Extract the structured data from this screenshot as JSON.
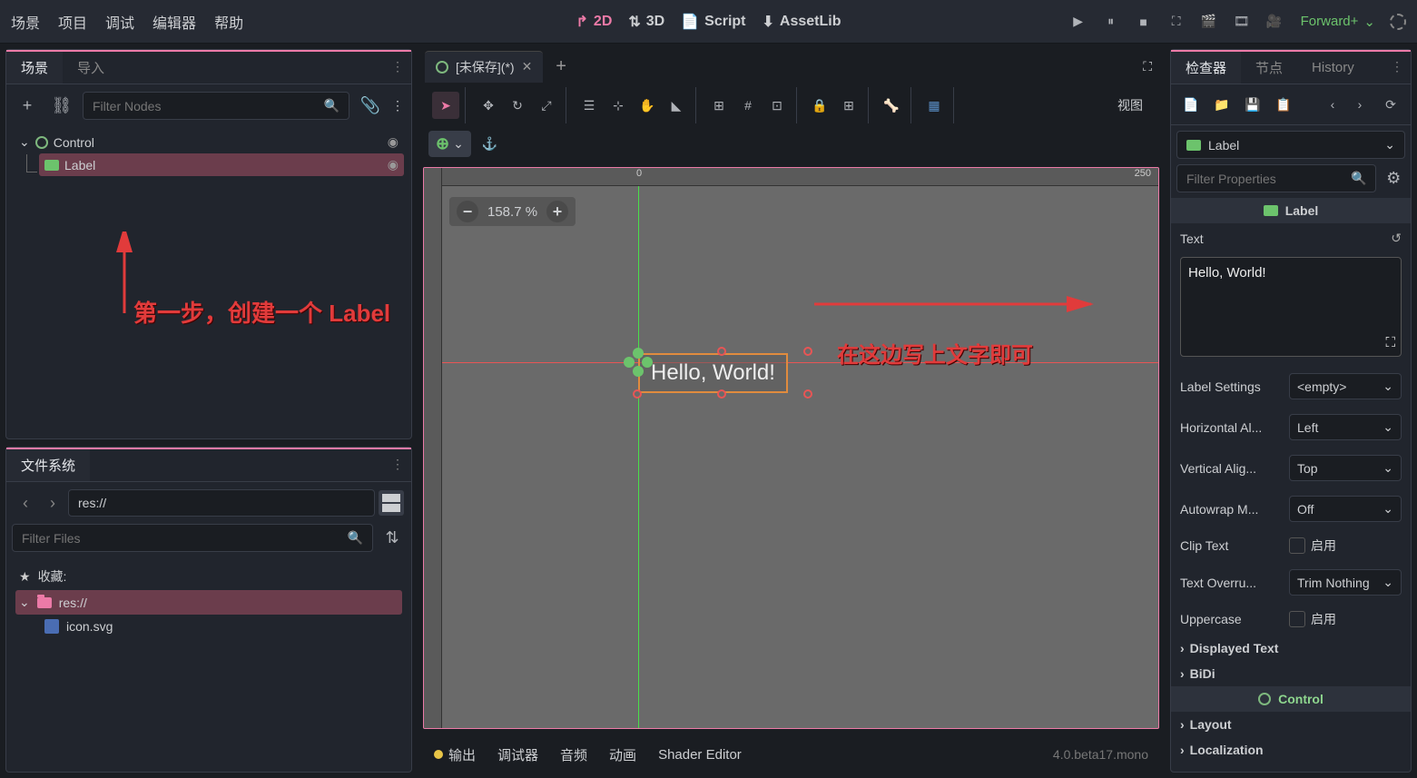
{
  "menubar": [
    "场景",
    "项目",
    "调试",
    "编辑器",
    "帮助"
  ],
  "view_modes": {
    "2d": "2D",
    "3d": "3D",
    "script": "Script",
    "assetlib": "AssetLib"
  },
  "renderer": "Forward+",
  "left": {
    "scene_tabs": {
      "scene": "场景",
      "import": "导入"
    },
    "filter_nodes_placeholder": "Filter Nodes",
    "tree": {
      "root": "Control",
      "child": "Label"
    },
    "annotation1": "第一步，创建一个 Label",
    "fs_title": "文件系统",
    "fs_path": "res://",
    "filter_files_placeholder": "Filter Files",
    "fs_items": {
      "fav": "收藏:",
      "res": "res://",
      "icon": "icon.svg"
    }
  },
  "center": {
    "tab_title": "[未保存](*)",
    "view_btn": "视图",
    "zoom": "158.7 %",
    "ruler_0": "0",
    "ruler_250": "250",
    "canvas_text": "Hello, World!",
    "annotation2": "在这边写上文字即可",
    "bottom": {
      "output": "输出",
      "debugger": "调试器",
      "audio": "音频",
      "anim": "动画",
      "shader": "Shader Editor",
      "version": "4.0.beta17.mono"
    }
  },
  "inspector": {
    "tabs": {
      "inspector": "检查器",
      "node": "节点",
      "history": "History"
    },
    "resource": "Label",
    "filter_placeholder": "Filter Properties",
    "section_label": "Label",
    "section_control": "Control",
    "props": {
      "text": "Text",
      "text_value": "Hello, World!",
      "label_settings": "Label Settings",
      "label_settings_val": "<empty>",
      "h_align": "Horizontal Al...",
      "h_align_val": "Left",
      "v_align": "Vertical Alig...",
      "v_align_val": "Top",
      "autowrap": "Autowrap M...",
      "autowrap_val": "Off",
      "clip_text": "Clip Text",
      "enable": "启用",
      "text_overrun": "Text Overru...",
      "text_overrun_val": "Trim Nothing",
      "uppercase": "Uppercase",
      "displayed_text": "Displayed Text",
      "bidi": "BiDi",
      "layout": "Layout",
      "localization": "Localization"
    }
  }
}
